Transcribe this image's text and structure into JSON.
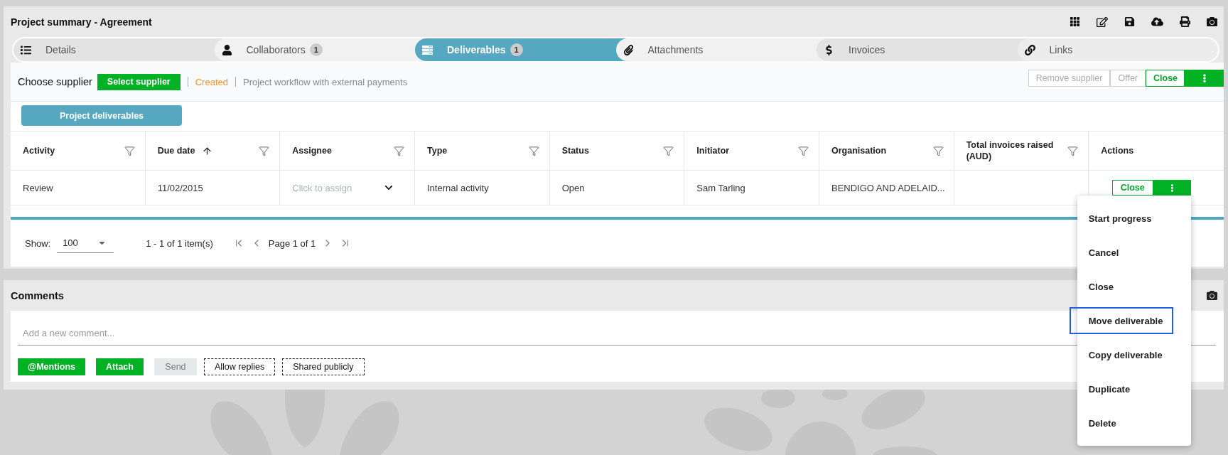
{
  "header": {
    "title": "Project summary - Agreement"
  },
  "tabs": [
    {
      "label": "Details",
      "selected": false
    },
    {
      "label": "Collaborators",
      "badge": "1",
      "selected": false
    },
    {
      "label": "Deliverables",
      "badge": "1",
      "selected": true
    },
    {
      "label": "Attachments",
      "selected": false
    },
    {
      "label": "Invoices",
      "selected": false
    },
    {
      "label": "Links",
      "selected": false
    }
  ],
  "supplier_bar": {
    "label": "Choose supplier",
    "select_button": "Select supplier",
    "status": "Created",
    "workflow": "Project workflow with external payments",
    "actions": [
      {
        "label": "Remove supplier",
        "disabled": true
      },
      {
        "label": "Offer",
        "disabled": true
      },
      {
        "label": "Close",
        "disabled": false
      }
    ]
  },
  "section_button": "Project deliverables",
  "table": {
    "columns": [
      {
        "label": "Activity",
        "filterable": true,
        "sorted": false
      },
      {
        "label": "Due date",
        "filterable": true,
        "sorted": true
      },
      {
        "label": "Assignee",
        "filterable": true,
        "sorted": false
      },
      {
        "label": "Type",
        "filterable": true,
        "sorted": false
      },
      {
        "label": "Status",
        "filterable": true,
        "sorted": false
      },
      {
        "label": "Initiator",
        "filterable": true,
        "sorted": false
      },
      {
        "label": "Organisation",
        "filterable": true,
        "sorted": false
      },
      {
        "label": "Total invoices raised (AUD)",
        "filterable": true,
        "sorted": false
      },
      {
        "label": "Actions",
        "filterable": false,
        "sorted": false
      }
    ],
    "rows": [
      {
        "activity": "Review",
        "due_date": "11/02/2015",
        "assignee_placeholder": "Click to assign",
        "type": "Internal activity",
        "status": "Open",
        "initiator": "Sam Tarling",
        "organisation": "BENDIGO AND ADELAID...",
        "action": "Close"
      }
    ]
  },
  "pager": {
    "show_label": "Show:",
    "page_size": "100",
    "range": "1 - 1 of 1 item(s)",
    "page": "Page 1 of 1"
  },
  "row_menu": {
    "items": [
      {
        "label": "Start progress",
        "focused": false
      },
      {
        "label": "Cancel",
        "focused": false
      },
      {
        "label": "Close",
        "focused": false
      },
      {
        "label": "Move deliverable",
        "focused": true
      },
      {
        "label": "Copy deliverable",
        "focused": false
      },
      {
        "label": "Duplicate",
        "focused": false
      },
      {
        "label": "Delete",
        "focused": false
      }
    ]
  },
  "comments": {
    "title": "Comments",
    "placeholder": "Add a new comment...",
    "buttons": [
      {
        "label": "@Mentions",
        "kind": "primary"
      },
      {
        "label": "Attach",
        "kind": "primary"
      },
      {
        "label": "Send",
        "kind": "disabled"
      },
      {
        "label": "Allow replies",
        "kind": "toggle"
      },
      {
        "label": "Shared publicly",
        "kind": "toggle"
      }
    ]
  }
}
